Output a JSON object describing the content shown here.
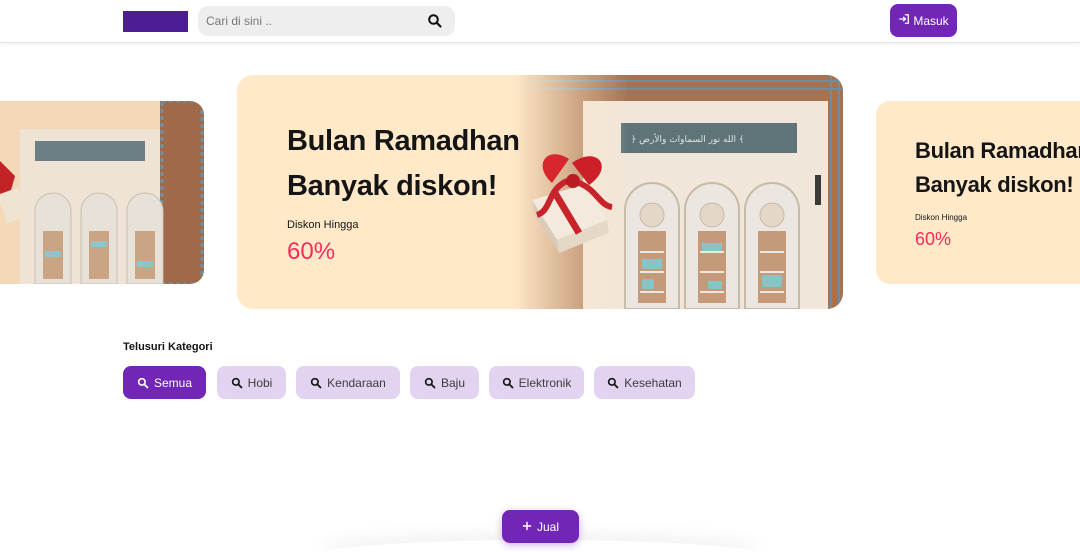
{
  "header": {
    "search": {
      "placeholder": "Cari di sini ..",
      "value": ""
    },
    "login_label": "Masuk"
  },
  "banners": [
    {
      "title_line1": "Bulan Ramadhan",
      "title_line2": "Banyak diskon!",
      "subtitle": "Diskon Hingga",
      "discount": "60%"
    },
    {
      "title_line1": "Bulan Ramadhan",
      "title_line2": "Banyak diskon!",
      "subtitle": "Diskon Hingga",
      "discount": "60%"
    }
  ],
  "categories": {
    "title": "Telusuri Kategori",
    "items": [
      {
        "label": "Semua",
        "active": true
      },
      {
        "label": "Hobi",
        "active": false
      },
      {
        "label": "Kendaraan",
        "active": false
      },
      {
        "label": "Baju",
        "active": false
      },
      {
        "label": "Elektronik",
        "active": false
      },
      {
        "label": "Kesehatan",
        "active": false
      }
    ]
  },
  "sell_label": "Jual",
  "colors": {
    "brand": "#7126b5",
    "logo": "#4c1d95",
    "chip_bg": "#e2d4f0",
    "banner_bg": "#ffe9c9",
    "discount": "#fa2c5a"
  },
  "icons": [
    "search-icon",
    "login-icon",
    "gift-icon",
    "plus-icon"
  ]
}
